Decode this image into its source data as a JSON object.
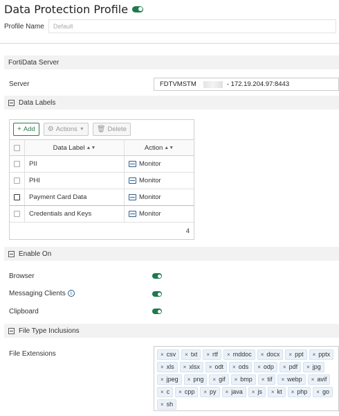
{
  "page": {
    "title": "Data Protection Profile",
    "profile_name_label": "Profile Name",
    "profile_name_placeholder": "Default"
  },
  "sections": {
    "fortidata_server": "FortiData Server",
    "data_labels": "Data Labels",
    "enable_on": "Enable On",
    "file_type_inclusions": "File Type Inclusions"
  },
  "server": {
    "label": "Server",
    "value_prefix": "FDTVMSTM",
    "value_suffix": "- 172.19.204.97:8443"
  },
  "toolbar": {
    "add_label": "Add",
    "actions_label": "Actions",
    "delete_label": "Delete"
  },
  "table": {
    "col_label": "Data Label",
    "col_action": "Action",
    "rows": [
      {
        "label": "PII",
        "action": "Monitor"
      },
      {
        "label": "PHI",
        "action": "Monitor"
      },
      {
        "label": "Payment Card Data",
        "action": "Monitor"
      },
      {
        "label": "Credentials and Keys",
        "action": "Monitor"
      }
    ],
    "count": "4"
  },
  "enable_on": {
    "browser": "Browser",
    "messaging_clients": "Messaging Clients",
    "clipboard": "Clipboard"
  },
  "file_ext": {
    "label": "File Extensions",
    "items": [
      "csv",
      "txt",
      "rtf",
      "mddoc",
      "docx",
      "ppt",
      "pptx",
      "xls",
      "xlsx",
      "odt",
      "ods",
      "odp",
      "pdf",
      "jpg",
      "jpeg",
      "png",
      "gif",
      "bmp",
      "tif",
      "webp",
      "avif",
      "c",
      "cpp",
      "py",
      "java",
      "js",
      "kt",
      "php",
      "go",
      "sh"
    ]
  },
  "colors": {
    "accent_green": "#1e7a4c",
    "chip_bg": "#eaf1f8",
    "header_bg": "#f2f2f2"
  }
}
